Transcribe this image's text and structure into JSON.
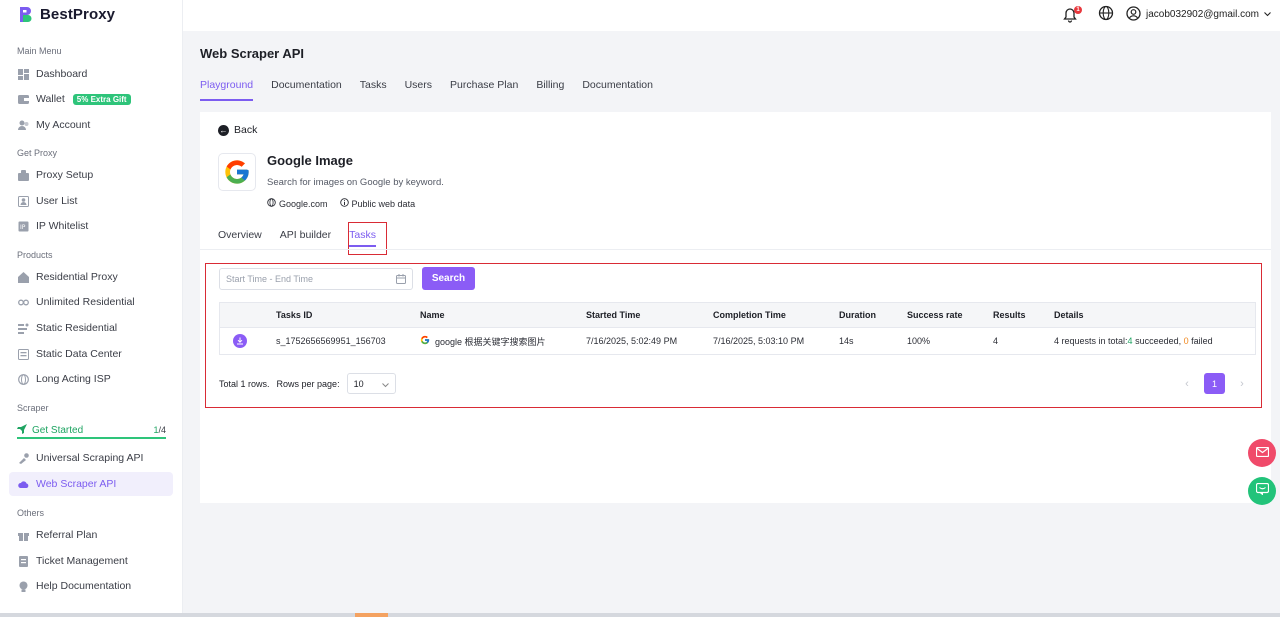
{
  "brand": {
    "name": "BestProxy"
  },
  "sidebar": {
    "sections": {
      "main": "Main Menu",
      "get_proxy": "Get Proxy",
      "products": "Products",
      "scraper": "Scraper",
      "others": "Others"
    },
    "items": {
      "dashboard": "Dashboard",
      "wallet": "Wallet",
      "wallet_badge": "5% Extra Gift",
      "my_account": "My Account",
      "proxy_setup": "Proxy Setup",
      "user_list": "User List",
      "ip_whitelist": "IP Whitelist",
      "residential_proxy": "Residential Proxy",
      "unlimited_residential": "Unlimited Residential",
      "static_residential": "Static Residential",
      "static_data_center": "Static Data Center",
      "long_acting_isp": "Long Acting ISP",
      "universal_scraping_api": "Universal Scraping API",
      "web_scraper_api": "Web Scraper API",
      "referral_plan": "Referral Plan",
      "ticket_management": "Ticket Management",
      "help_documentation": "Help Documentation"
    },
    "get_started": {
      "label": "Get Started",
      "done": "1",
      "total": "/4"
    }
  },
  "topbar": {
    "notification_count": "1",
    "user_email": "jacob032902@gmail.com"
  },
  "page": {
    "title": "Web Scraper API",
    "tabs": [
      "Playground",
      "Documentation",
      "Tasks",
      "Users",
      "Purchase Plan",
      "Billing",
      "Documentation"
    ]
  },
  "product": {
    "back_label": "Back",
    "name": "Google Image",
    "description": "Search for images on Google by keyword.",
    "domain": "Google.com",
    "data_type": "Public web data",
    "tabs": [
      "Overview",
      "API builder",
      "Tasks"
    ]
  },
  "filter": {
    "date_placeholder": "Start Time - End Time",
    "search_label": "Search"
  },
  "table": {
    "headers": [
      "Tasks ID",
      "Name",
      "Started Time",
      "Completion Time",
      "Duration",
      "Success rate",
      "Results",
      "Details"
    ],
    "rows": [
      {
        "task_id": "s_1752656569951_156703",
        "name": "google 根据关键字搜索图片",
        "started": "7/16/2025, 5:02:49 PM",
        "completed": "7/16/2025, 5:03:10 PM",
        "duration": "14s",
        "success_rate": "100%",
        "results": "4",
        "details_prefix": "4 requests in total: ",
        "details_succeeded_count": "4",
        "details_succeeded_label": " succeeded, ",
        "details_failed_count": "0",
        "details_failed_label": " failed"
      }
    ]
  },
  "pagination": {
    "total_label": "Total 1 rows.",
    "rows_per_page_label": "Rows per page:",
    "rows_per_page": "10",
    "current_page": "1"
  },
  "colors": {
    "accent": "#8b5cf6",
    "success": "#1fa462",
    "danger": "#d92b35"
  },
  "icons": [
    "bell-icon",
    "globe-icon",
    "user-circle-icon",
    "download-icon",
    "calendar-icon",
    "mail-icon",
    "chat-icon"
  ]
}
